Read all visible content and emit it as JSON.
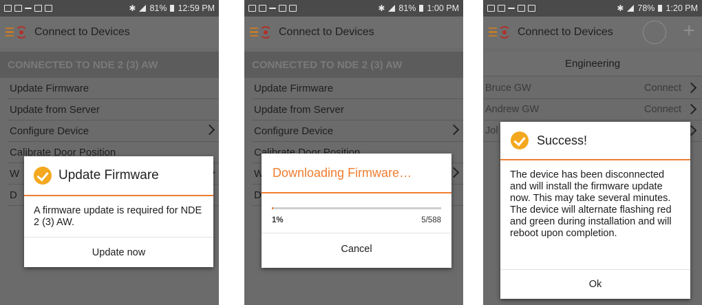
{
  "screens": [
    {
      "status": {
        "battery": "81%",
        "time": "12:59 PM"
      },
      "appbar_title": "Connect to Devices",
      "connected_banner": "CONNECTED TO NDE 2 (3) AW",
      "menu": [
        {
          "label": "Update Firmware"
        },
        {
          "label": "Update from Server"
        },
        {
          "label": "Configure Device"
        },
        {
          "label": "Calibrate Door Position"
        },
        {
          "label": "W"
        },
        {
          "label": "D"
        }
      ],
      "dialog": {
        "title": "Update Firmware",
        "body": "A firmware update is required for NDE 2 (3) AW.",
        "button": "Update now"
      }
    },
    {
      "status": {
        "battery": "81%",
        "time": "1:00 PM"
      },
      "appbar_title": "Connect to Devices",
      "connected_banner": "CONNECTED TO NDE 2 (3) AW",
      "menu": [
        {
          "label": "Update Firmware"
        },
        {
          "label": "Update from Server"
        },
        {
          "label": "Configure Device"
        },
        {
          "label": "Calibrate Door Position"
        },
        {
          "label": "W"
        },
        {
          "label": "D"
        }
      ],
      "dialog": {
        "title": "Downloading Firmware…",
        "progress_percent_label": "1%",
        "progress_count_label": "5/588",
        "progress_fraction": 0.0085,
        "button": "Cancel"
      }
    },
    {
      "status": {
        "battery": "78%",
        "time": "1:20 PM"
      },
      "appbar_title": "Connect to Devices",
      "group_title": "Engineering",
      "devices": [
        {
          "name": "Bruce GW",
          "action": "Connect"
        },
        {
          "name": "Andrew GW",
          "action": "Connect"
        },
        {
          "name": "Jol",
          "action": ""
        }
      ],
      "dialog": {
        "title": "Success!",
        "body": "The device has been disconnected and will install the firmware update now. This may take several minutes. The device will alternate flashing red and green during installation and will reboot upon completion.",
        "button": "Ok"
      }
    }
  ],
  "colors": {
    "accent": "#ef7d2e",
    "check": "#f4a81f",
    "logo_red": "#b0302a"
  }
}
